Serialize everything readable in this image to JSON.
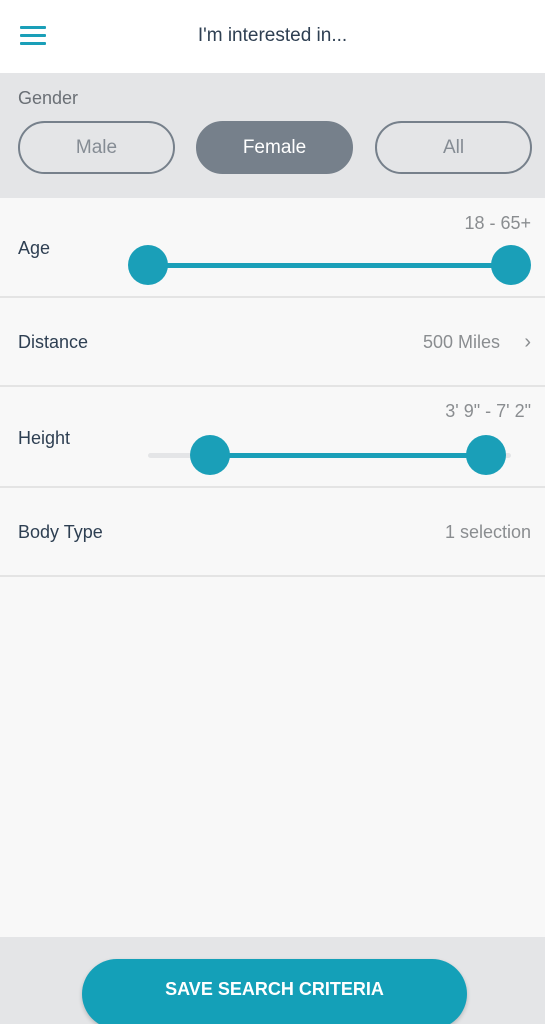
{
  "header": {
    "menu_icon": "hamburger-menu-icon",
    "title": "I'm interested in..."
  },
  "gender": {
    "label": "Gender",
    "options": [
      "Male",
      "Female",
      "All"
    ],
    "selected": "Female"
  },
  "filters": {
    "age": {
      "label": "Age",
      "value": "18 - 65+",
      "range_fraction": [
        0.0,
        1.0
      ]
    },
    "distance": {
      "label": "Distance",
      "value": "500 Miles",
      "icon": "chevron-right-icon"
    },
    "height": {
      "label": "Height",
      "value": "3' 9\" - 7' 2\"",
      "range_fraction": [
        0.17,
        0.93
      ]
    },
    "body_type": {
      "label": "Body Type",
      "value": "1 selection"
    }
  },
  "footer": {
    "save_label": "SAVE SEARCH CRITERIA"
  },
  "colors": {
    "accent": "#1a9fb8",
    "selected_segment": "#76808b",
    "section_bg": "#e4e5e7"
  }
}
